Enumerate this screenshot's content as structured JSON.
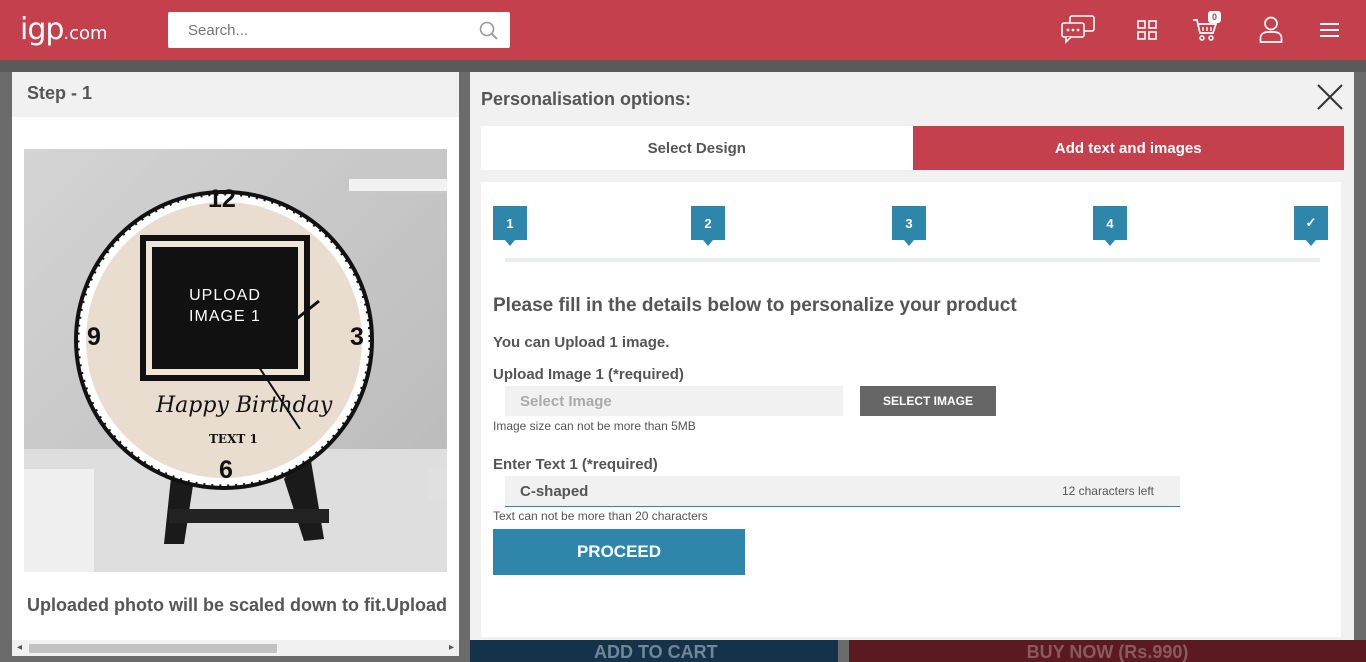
{
  "header": {
    "logo_main": "igp",
    "logo_domain": ".com",
    "search_placeholder": "Search...",
    "cart_count": "0",
    "icons": [
      "chat-icon",
      "grid-icon",
      "cart-icon",
      "user-icon",
      "menu-icon"
    ]
  },
  "background": {
    "add_to_cart": "ADD TO CART",
    "buy_now": "BUY NOW (Rs.990)"
  },
  "left_panel": {
    "title": "Step - 1",
    "caption": "Uploaded photo will be scaled down to fit.Upload",
    "clock": {
      "numbers": [
        "12",
        "3",
        "6",
        "9"
      ],
      "upload_label_line1": "UPLOAD",
      "upload_label_line2": "IMAGE 1",
      "greeting": "Happy Birthday",
      "text_label": "TEXT 1"
    }
  },
  "right_panel": {
    "title": "Personalisation options:",
    "tabs": [
      {
        "label": "Select Design",
        "active": false
      },
      {
        "label": "Add text and images",
        "active": true
      }
    ],
    "steps": [
      "1",
      "2",
      "3",
      "4",
      "✓"
    ],
    "heading": "Please fill in the details below to personalize your product",
    "upload_count": "You can Upload 1 image.",
    "upload_label": "Upload Image 1 (*required)",
    "select_placeholder": "Select Image",
    "select_button": "SELECT IMAGE",
    "image_hint": "Image size can not be more than 5MB",
    "text_label": "Enter Text 1 (*required)",
    "text_value": "C-shaped",
    "chars_left": "12 characters left",
    "text_hint": "Text can not be more than 20 characters",
    "proceed_button": "PROCEED"
  },
  "colors": {
    "brand": "#c4404d",
    "accent": "#2e86ab",
    "panel_bg": "#f1f1f1"
  }
}
